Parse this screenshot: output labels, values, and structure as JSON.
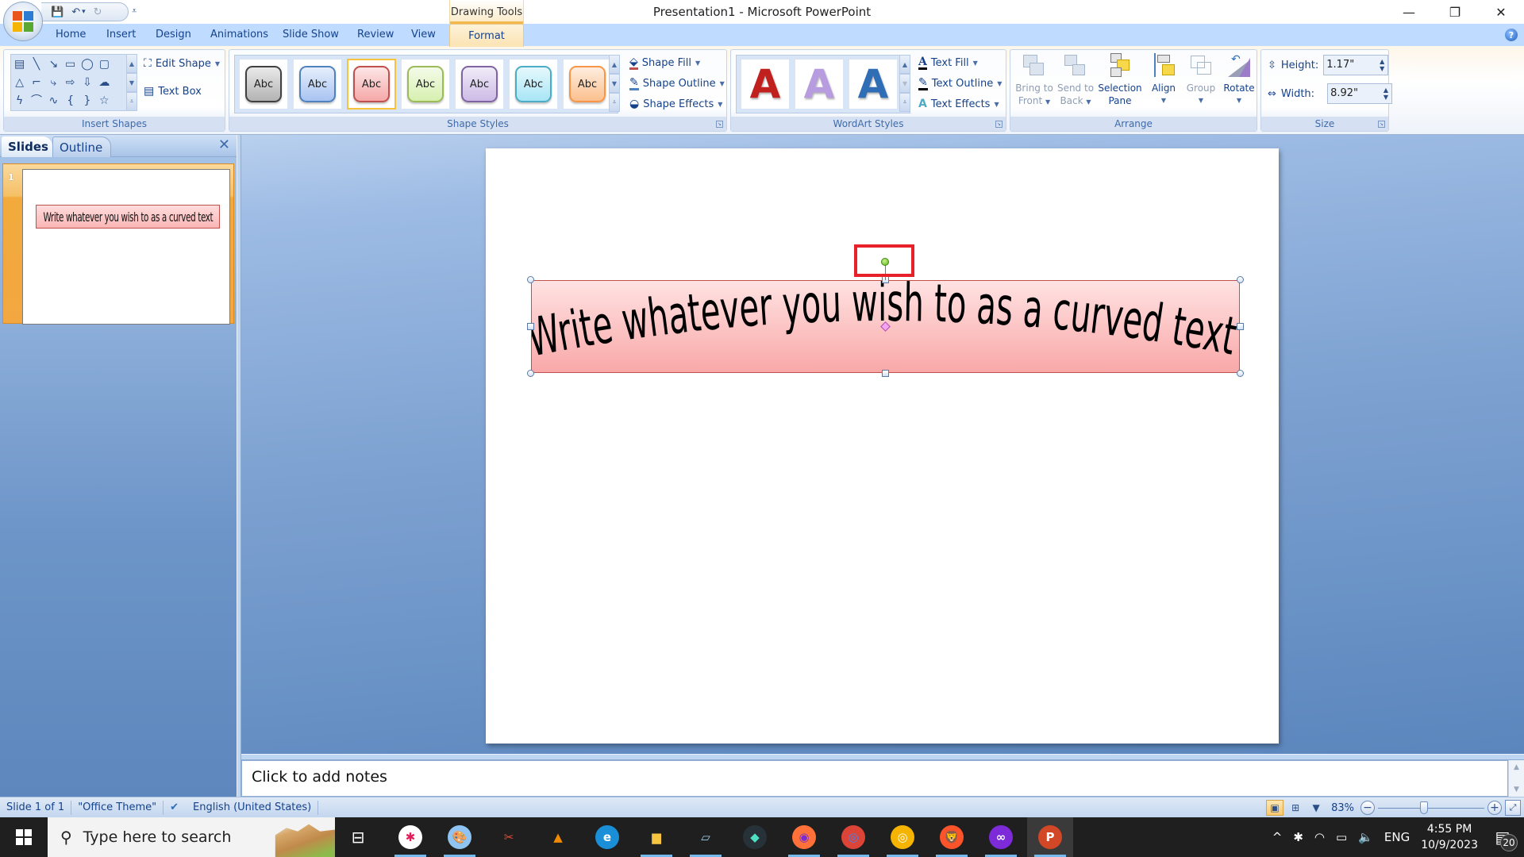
{
  "window": {
    "title": "Presentation1 - Microsoft PowerPoint",
    "contextual_header": "Drawing Tools",
    "controls": {
      "minimize": "—",
      "restore": "❐",
      "close": "✕"
    }
  },
  "quick_access": {
    "save": "💾",
    "undo": "↶",
    "undo_dd": "▾",
    "redo": "↻",
    "customize": "⩡"
  },
  "tabs": [
    {
      "label": "Home"
    },
    {
      "label": "Insert"
    },
    {
      "label": "Design"
    },
    {
      "label": "Animations"
    },
    {
      "label": "Slide Show"
    },
    {
      "label": "Review"
    },
    {
      "label": "View"
    },
    {
      "label": "Format",
      "active": true
    }
  ],
  "help": "?",
  "ribbon": {
    "insert_shapes": {
      "label": "Insert Shapes",
      "shapes": [
        "▤",
        "╲",
        "↘",
        "▭",
        "◯",
        "▢",
        "△",
        "⌐",
        "⤷",
        "⇨",
        "⇩",
        "☁",
        "ϟ",
        "⌒",
        "∿",
        "{",
        "}",
        "☆"
      ],
      "edit_shape": "Edit Shape",
      "text_box": "Text Box"
    },
    "shape_styles": {
      "label": "Shape Styles",
      "styles": [
        {
          "text": "Abc",
          "fill": "#b3b3b3",
          "border": "#404040"
        },
        {
          "text": "Abc",
          "fill": "#a8c4f2",
          "border": "#4f81bd"
        },
        {
          "text": "Abc",
          "fill": "#f6a8a8",
          "border": "#c0504d",
          "selected": true
        },
        {
          "text": "Abc",
          "fill": "#d7f0b0",
          "border": "#9bbb59"
        },
        {
          "text": "Abc",
          "fill": "#cdbbe6",
          "border": "#8064a2"
        },
        {
          "text": "Abc",
          "fill": "#a8e6f6",
          "border": "#4bacc6"
        },
        {
          "text": "Abc",
          "fill": "#fbc08e",
          "border": "#f79646"
        }
      ],
      "shape_fill": "Shape Fill",
      "shape_outline": "Shape Outline",
      "shape_effects": "Shape Effects"
    },
    "wordart_styles": {
      "label": "WordArt Styles",
      "styles": [
        {
          "glyph": "A",
          "color": "#c0201e"
        },
        {
          "glyph": "A",
          "color": "#b79ce0"
        },
        {
          "glyph": "A",
          "color": "#2f6db5"
        }
      ],
      "text_fill": "Text Fill",
      "text_outline": "Text Outline",
      "text_effects": "Text Effects"
    },
    "arrange": {
      "label": "Arrange",
      "bring_to_front": [
        "Bring to",
        "Front"
      ],
      "send_to_back": [
        "Send to",
        "Back"
      ],
      "selection_pane": [
        "Selection",
        "Pane"
      ],
      "align": "Align",
      "group": "Group",
      "rotate": "Rotate"
    },
    "size": {
      "label": "Size",
      "height_label": "Height:",
      "height_value": "1.17\"",
      "width_label": "Width:",
      "width_value": "8.92\""
    }
  },
  "slides_pane": {
    "tab_slides": "Slides",
    "tab_outline": "Outline",
    "close": "✕",
    "thumbnails": [
      {
        "number": "1",
        "text": "Write whatever you wish to as a curved text"
      }
    ]
  },
  "slide": {
    "wordart_text": "Write whatever you wish to as a curved text",
    "shape_fill_top": "#ffe2e2",
    "shape_fill_bottom": "#f9a8a8",
    "shape_border": "#c0504d",
    "highlight_color": "#e8202a"
  },
  "notes": {
    "placeholder": "Click to add notes"
  },
  "status_bar": {
    "slide_info": "Slide 1 of 1",
    "theme": "\"Office Theme\"",
    "language": "English (United States)",
    "zoom": "83%",
    "zoom_fraction": 0.43
  },
  "taskbar": {
    "search_placeholder": "Type here to search",
    "apps": [
      {
        "name": "slack",
        "glyph": "✱",
        "bg": "#ffffff",
        "fg": "#e01e5a",
        "open": true
      },
      {
        "name": "paint",
        "glyph": "🎨",
        "bg": "#8ec3f2",
        "fg": "#fff",
        "open": true
      },
      {
        "name": "snipping-tool",
        "glyph": "✂",
        "bg": "#1f1f1f",
        "fg": "#e34a2f",
        "open": false
      },
      {
        "name": "vlc",
        "glyph": "▲",
        "bg": "#1f1f1f",
        "fg": "#f08a00",
        "open": false
      },
      {
        "name": "edge",
        "glyph": "e",
        "bg": "#1a8fd8",
        "fg": "#fff",
        "open": false
      },
      {
        "name": "file-explorer",
        "glyph": "▆",
        "bg": "#1f1f1f",
        "fg": "#f5c542",
        "open": true
      },
      {
        "name": "notepad",
        "glyph": "▱",
        "bg": "#1f1f1f",
        "fg": "#9ed1ee",
        "open": true
      },
      {
        "name": "filmora",
        "glyph": "◆",
        "bg": "#263238",
        "fg": "#4ee0c0",
        "open": false
      },
      {
        "name": "firefox",
        "glyph": "◉",
        "bg": "#ff7139",
        "fg": "#7b2ecf",
        "open": true
      },
      {
        "name": "chrome",
        "glyph": "◎",
        "bg": "#db4437",
        "fg": "#4285f4",
        "open": true
      },
      {
        "name": "chrome-canary",
        "glyph": "◎",
        "bg": "#f6b400",
        "fg": "#fff",
        "open": true
      },
      {
        "name": "brave",
        "glyph": "🦁",
        "bg": "#fb542b",
        "fg": "#fff",
        "open": true
      },
      {
        "name": "tor-browser",
        "glyph": "∞",
        "bg": "#7d2ad9",
        "fg": "#fff",
        "open": true
      },
      {
        "name": "powerpoint",
        "glyph": "P",
        "bg": "#d24726",
        "fg": "#fff",
        "open": true,
        "active": true
      }
    ],
    "tray": {
      "chevron": "^",
      "language": "ENG",
      "time": "4:55 PM",
      "date": "10/9/2023",
      "notifications": "20"
    }
  }
}
